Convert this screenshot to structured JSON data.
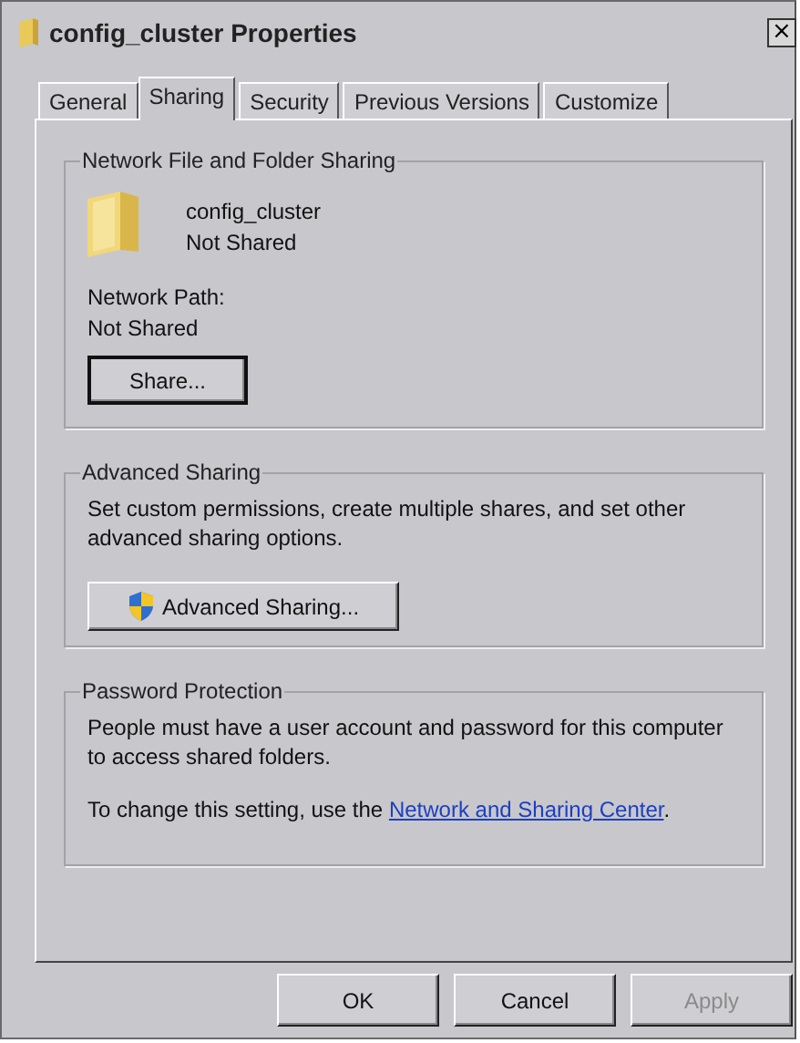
{
  "window": {
    "title": "config_cluster Properties",
    "close": "×"
  },
  "tabs": [
    {
      "label": "General",
      "selected": false
    },
    {
      "label": "Sharing",
      "selected": true
    },
    {
      "label": "Security",
      "selected": false
    },
    {
      "label": "Previous Versions",
      "selected": false
    },
    {
      "label": "Customize",
      "selected": false
    }
  ],
  "network_sharing": {
    "heading": "Network File and Folder Sharing",
    "name": "config_cluster",
    "status": "Not Shared",
    "path_label": "Network Path:",
    "path": "Not Shared",
    "button": "Share..."
  },
  "advanced_sharing": {
    "heading": "Advanced Sharing",
    "description": "Set custom permissions, create multiple shares, and set other advanced sharing options.",
    "button": "Advanced Sharing..."
  },
  "password_protection": {
    "heading": "Password Protection",
    "description": "People must have a user account and password for this computer to access shared folders.",
    "change_text": "To change this setting, use the",
    "link": "Network and Sharing Center",
    "after_link": "."
  },
  "buttons": [
    {
      "label": "OK",
      "disabled": false
    },
    {
      "label": "Cancel",
      "disabled": false
    },
    {
      "label": "Apply",
      "disabled": true
    }
  ]
}
